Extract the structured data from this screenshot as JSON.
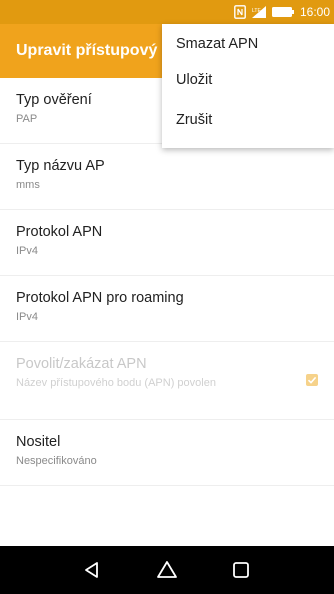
{
  "status_bar": {
    "time": "16:00",
    "icons": [
      "nfc-icon",
      "signal-icon",
      "battery-icon"
    ]
  },
  "app_bar": {
    "title": "Upravit přístupový bod"
  },
  "overflow_menu": {
    "items": [
      {
        "label": "Smazat APN"
      },
      {
        "label": "Uložit"
      },
      {
        "label": "Zrušit"
      }
    ]
  },
  "settings": [
    {
      "title": "Typ ověření",
      "summary": "PAP"
    },
    {
      "title": "Typ názvu AP",
      "summary": "mms"
    },
    {
      "title": "Protokol APN",
      "summary": "IPv4"
    },
    {
      "title": "Protokol APN pro roaming",
      "summary": "IPv4"
    },
    {
      "title": "Povolit/zakázat APN",
      "summary": "Název přístupového bodu (APN) povolen",
      "checked": true,
      "enabled": false
    },
    {
      "title": "Nositel",
      "summary": "Nespecifikováno"
    }
  ],
  "nav_bar": {
    "buttons": [
      "back-icon",
      "home-icon",
      "recents-icon"
    ]
  },
  "colors": {
    "status_bar": "#e19a10",
    "app_bar": "#f0a31c",
    "accent_checkbox": "#f6d28a",
    "nav_bar": "#000000"
  }
}
